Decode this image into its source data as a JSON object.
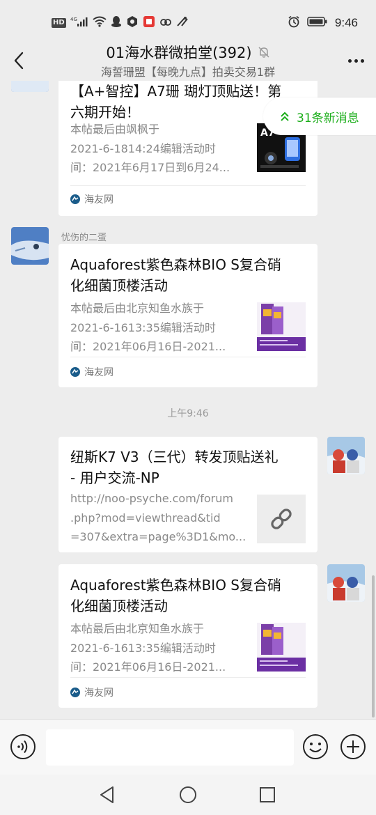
{
  "status_bar": {
    "hd_label": "HD",
    "network_label": "4G",
    "time": "9:46"
  },
  "header": {
    "title": "01海水群微拍堂(392)",
    "subtitle": "海誓珊盟【每晚九点】拍卖交易1群"
  },
  "new_messages": {
    "label": "31条新消息"
  },
  "messages": [
    {
      "type": "link-card",
      "title_lines": [
        "【A+智控】A7珊 瑚灯顶贴送！第",
        "六期开始！"
      ],
      "desc_lines": [
        "本帖最后由飒枫于",
        "2021-6-1814:24编辑活动时",
        "间：2021年6月17日到6月24..."
      ],
      "thumb_label": "A7",
      "source": "海友网"
    },
    {
      "type": "link-card",
      "sender": "忧伤的二蛋",
      "title_lines": [
        "Aquaforest紫色森林BIO S复合硝",
        "化细菌顶楼活动"
      ],
      "desc_lines": [
        "本帖最后由北京知鱼水族于",
        "2021-6-1613:35编辑活动时",
        "间：2021年06月16日-2021..."
      ],
      "source": "海友网"
    },
    {
      "type": "timestamp",
      "label": "上午9:46"
    },
    {
      "type": "link-card",
      "title_lines": [
        "纽斯K7 V3（三代）转发顶贴送礼",
        "- 用户交流-NP"
      ],
      "desc_lines": [
        "http://noo-psyche.com/forum",
        ".php?mod=viewthread&tid",
        "=307&extra=page%3D1&mo..."
      ],
      "thumb_icon": "link-icon"
    },
    {
      "type": "link-card",
      "title_lines": [
        "Aquaforest紫色森林BIO S复合硝",
        "化细菌顶楼活动"
      ],
      "desc_lines": [
        "本帖最后由北京知鱼水族于",
        "2021-6-1613:35编辑活动时",
        "间：2021年06月16日-2021..."
      ],
      "source": "海友网"
    }
  ],
  "input_bar": {
    "placeholder": ""
  },
  "colors": {
    "accent_green": "#1aad19",
    "background": "#ededed",
    "card": "#ffffff"
  }
}
